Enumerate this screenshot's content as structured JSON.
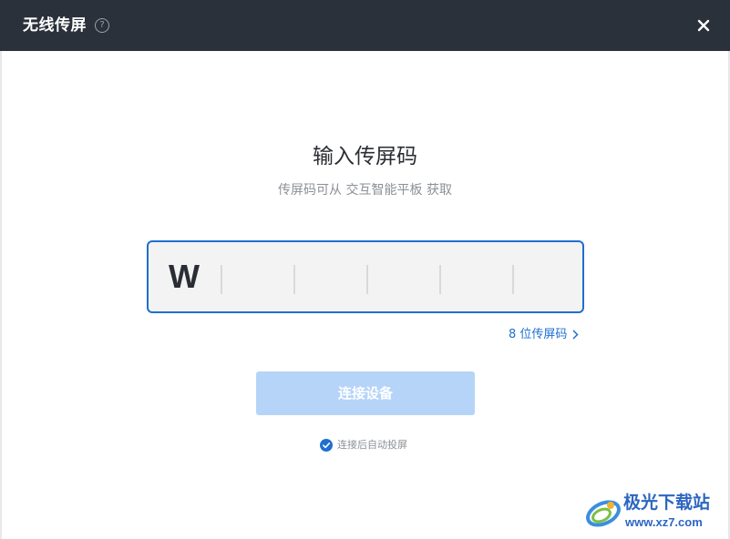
{
  "window": {
    "title": "无线传屏",
    "help_icon_glyph": "?"
  },
  "main": {
    "heading": "输入传屏码",
    "subheading": "传屏码可从 交互智能平板 获取",
    "code_input": {
      "entered_chars": [
        "W",
        "",
        "",
        "",
        "",
        ""
      ],
      "focus_color": "#1f6fd0"
    },
    "code_length_link": "8 位传屏码",
    "connect_button": "连接设备",
    "auto_cast": {
      "label": "连接后自动投屏",
      "checked": true
    }
  },
  "watermark": {
    "brand": "极光下载站",
    "url": "www.xz7.com"
  },
  "colors": {
    "titlebar": "#2b313b",
    "accent": "#1f6fd0",
    "button_disabled": "#b5d4f8"
  }
}
